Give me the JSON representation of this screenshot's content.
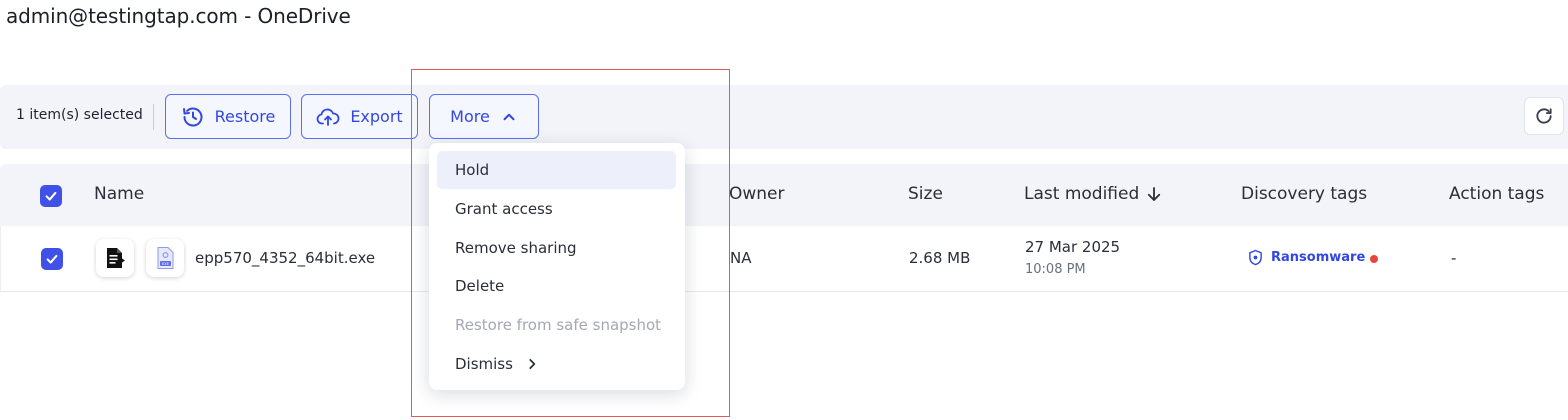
{
  "window": {
    "title": "admin@testingtap.com - OneDrive"
  },
  "toolbar": {
    "selected_text": "1 item(s) selected",
    "restore_label": "Restore",
    "export_label": "Export",
    "more_label": "More"
  },
  "table": {
    "headers": {
      "name": "Name",
      "owner": "Owner",
      "size": "Size",
      "last_modified": "Last modified",
      "discovery_tags": "Discovery tags",
      "action_tags": "Action tags"
    },
    "rows": [
      {
        "name": "epp570_4352_64bit.exe",
        "owner": "NA",
        "size": "2.68 MB",
        "date": "27 Mar 2025",
        "time": "10:08 PM",
        "discovery_tag": "Ransomware",
        "action_tags": "-"
      }
    ]
  },
  "more_menu": {
    "items": [
      {
        "label": "Hold",
        "state": "hovered"
      },
      {
        "label": "Grant access",
        "state": "enabled"
      },
      {
        "label": "Remove sharing",
        "state": "enabled"
      },
      {
        "label": "Delete",
        "state": "enabled"
      },
      {
        "label": "Restore from safe snapshot",
        "state": "disabled"
      },
      {
        "label": "Dismiss",
        "state": "enabled"
      }
    ]
  },
  "colors": {
    "accent": "#3f51e6",
    "toolbar_bg": "#f2f4f9",
    "tag_dot": "#e8453c",
    "highlight_box": "#e05a5a"
  },
  "icons": {
    "restore": "history-restore-icon",
    "export": "cloud-upload-icon",
    "more_chevron": "chevron-up-icon",
    "refresh": "refresh-icon",
    "sort": "arrow-down-icon",
    "tag": "shield-icon",
    "submenu": "chevron-right-icon"
  }
}
